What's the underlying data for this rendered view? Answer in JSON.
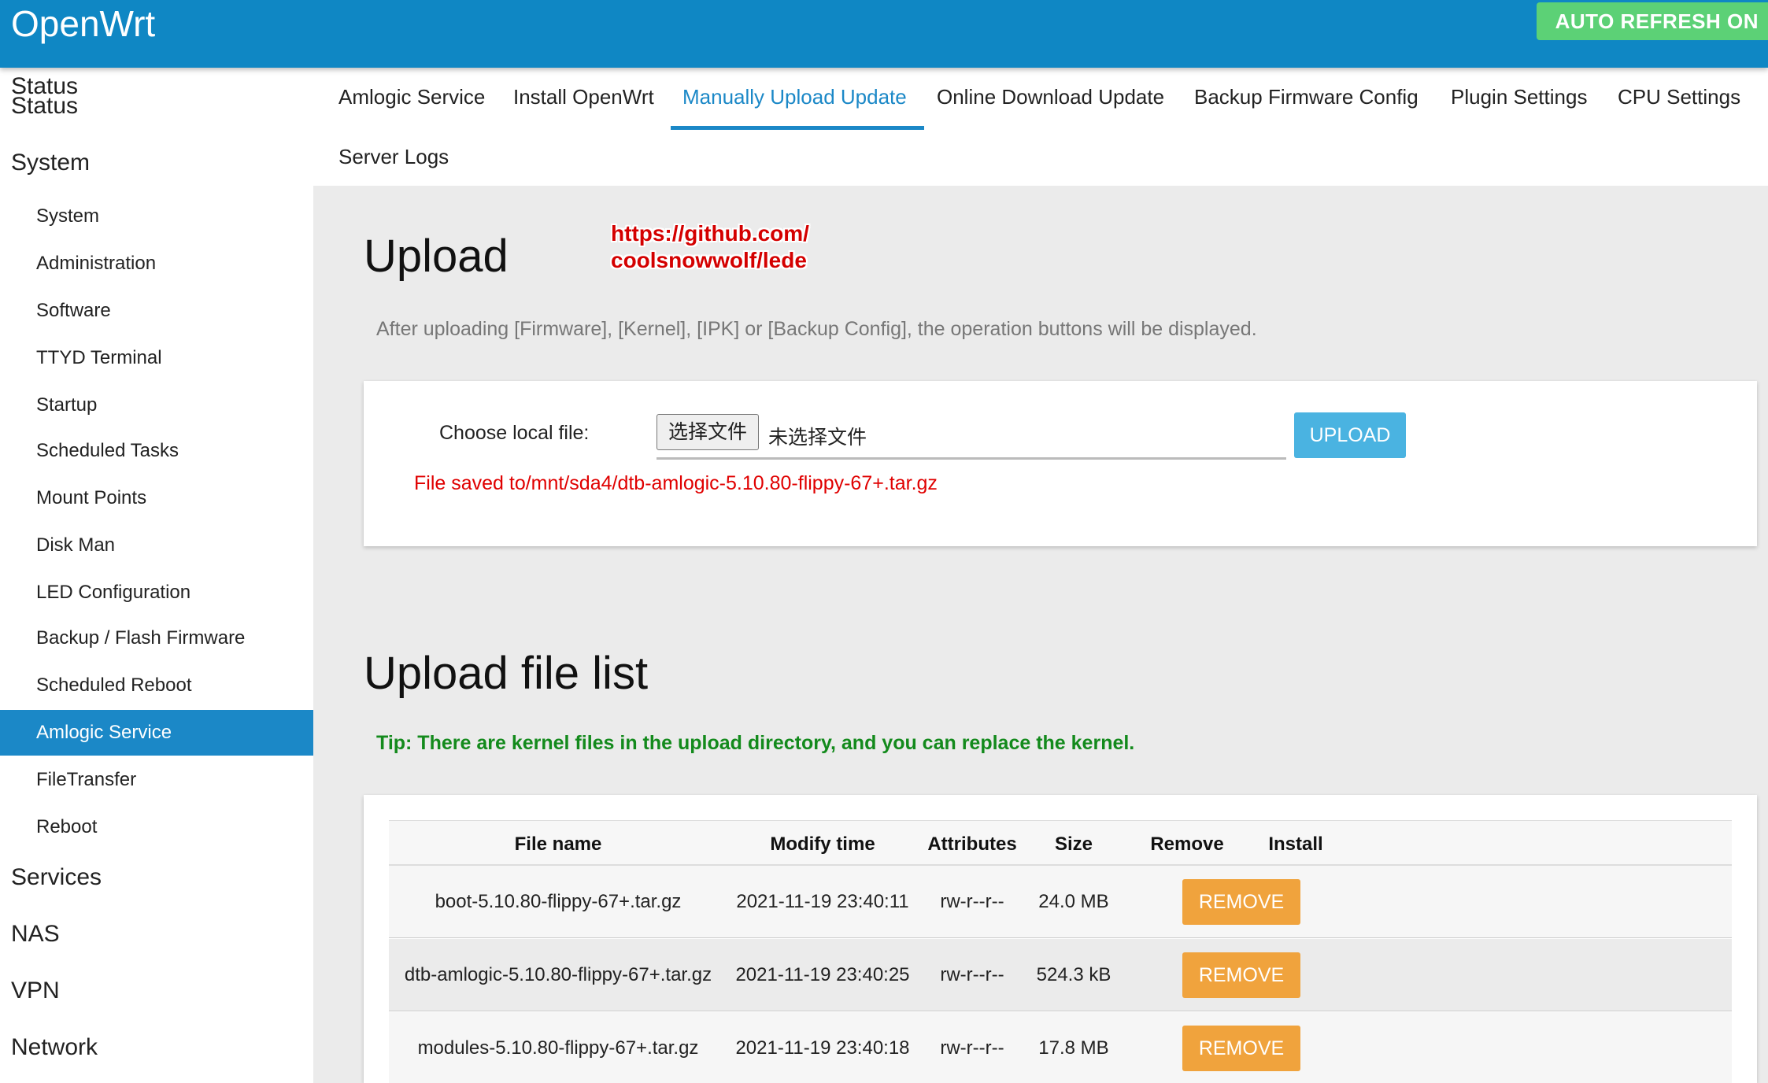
{
  "header": {
    "brand": "OpenWrt",
    "auto_refresh": "AUTO REFRESH ON"
  },
  "sidebar": {
    "groups": {
      "status": "Status",
      "system": "System",
      "services": "Services",
      "nas": "NAS",
      "vpn": "VPN",
      "network": "Network"
    },
    "items": [
      "System",
      "Administration",
      "Software",
      "TTYD Terminal",
      "Startup",
      "Scheduled Tasks",
      "Mount Points",
      "Disk Man",
      "LED Configuration",
      "Backup / Flash Firmware",
      "Scheduled Reboot",
      "Amlogic Service",
      "FileTransfer",
      "Reboot"
    ]
  },
  "tabs": [
    "Amlogic Service",
    "Install OpenWrt",
    "Manually Upload Update",
    "Online Download Update",
    "Backup Firmware Config",
    "Plugin Settings",
    "CPU Settings",
    "Server Logs"
  ],
  "upload": {
    "title": "Upload",
    "watermark_line1": "https://github.com/",
    "watermark_line2": "coolsnowwolf/lede",
    "description": "After uploading [Firmware], [Kernel], [IPK] or [Backup Config], the operation buttons will be displayed.",
    "choose_label": "Choose local file:",
    "file_button": "选择文件",
    "no_file": "未选择文件",
    "upload_button": "UPLOAD",
    "saved_message": "File saved to/mnt/sda4/dtb-amlogic-5.10.80-flippy-67+.tar.gz"
  },
  "file_list": {
    "title": "Upload file list",
    "tip": "Tip: There are kernel files in the upload directory, and you can replace the kernel.",
    "columns": {
      "name": "File name",
      "mtime": "Modify time",
      "attr": "Attributes",
      "size": "Size",
      "remove": "Remove",
      "install": "Install"
    },
    "rows": [
      {
        "name": "boot-5.10.80-flippy-67+.tar.gz",
        "mtime": "2021-11-19 23:40:11",
        "attr": "rw-r--r--",
        "size": "24.0 MB",
        "remove": "REMOVE"
      },
      {
        "name": "dtb-amlogic-5.10.80-flippy-67+.tar.gz",
        "mtime": "2021-11-19 23:40:25",
        "attr": "rw-r--r--",
        "size": "524.3 kB",
        "remove": "REMOVE"
      },
      {
        "name": "modules-5.10.80-flippy-67+.tar.gz",
        "mtime": "2021-11-19 23:40:18",
        "attr": "rw-r--r--",
        "size": "17.8 MB",
        "remove": "REMOVE"
      }
    ]
  }
}
